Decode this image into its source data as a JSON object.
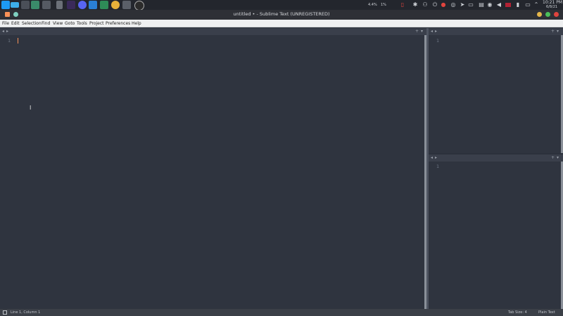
{
  "window": {
    "title": "untitled • - Sublime Text (UNREGISTERED)"
  },
  "menu": [
    "File",
    "Edit",
    "Selection",
    "Find",
    "View",
    "Goto",
    "Tools",
    "Project",
    "Preferences",
    "Help"
  ],
  "tray": {
    "cpu": "4.4%",
    "net": "1%",
    "time": "10:21 PM",
    "date": "6/8/21"
  },
  "editor": {
    "main_line": "1",
    "right_top_line": "1",
    "right_bottom_line": "1"
  },
  "status": {
    "left": "Line 1, Column 1",
    "tab_size": "Tab Size: 4",
    "syntax": "Plain Text"
  },
  "colors": {
    "accent": "#f99157",
    "close": "#e0443e",
    "minimize": "#e5b64a",
    "maximize": "#4bbf5a"
  }
}
